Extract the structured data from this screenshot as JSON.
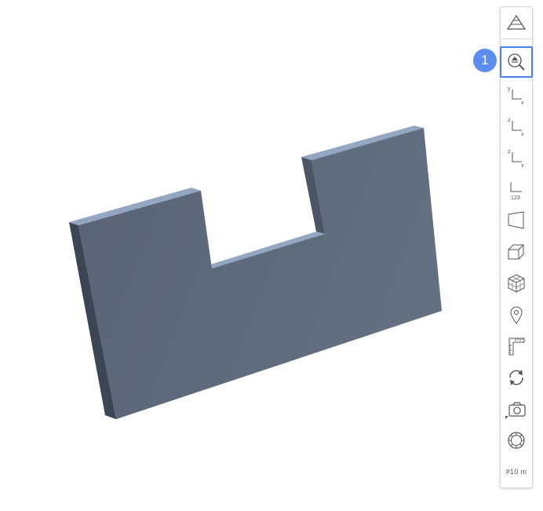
{
  "viewer": {
    "model": {
      "face_color": "#5d6a7b",
      "top_color": "#94a7c2",
      "side_color": "#3b4655"
    }
  },
  "toolbar": {
    "accent_color": "#4a7cf7",
    "buttons": [
      {
        "name": "perspective-toggle-icon"
      },
      {
        "name": "zoom-extents-icon"
      },
      {
        "name": "view-xy-icon",
        "axis_v": "y",
        "axis_h": "x"
      },
      {
        "name": "view-xz-icon",
        "axis_v": "z",
        "axis_h": "x"
      },
      {
        "name": "view-yz-icon",
        "axis_v": "z",
        "axis_h": "y"
      },
      {
        "name": "axis-numbers-icon",
        "label": "123"
      },
      {
        "name": "plane-view-icon"
      },
      {
        "name": "box-view-icon"
      },
      {
        "name": "cube-grid-icon"
      },
      {
        "name": "location-pin-icon"
      },
      {
        "name": "ruler-icon"
      },
      {
        "name": "rotate-icon"
      },
      {
        "name": "camera-icon"
      },
      {
        "name": "settings-wheel-icon"
      },
      {
        "name": "grid-scale-indicator",
        "label": "#10 m"
      }
    ]
  },
  "step_badge": {
    "number": "1",
    "color": "#5b8def"
  }
}
